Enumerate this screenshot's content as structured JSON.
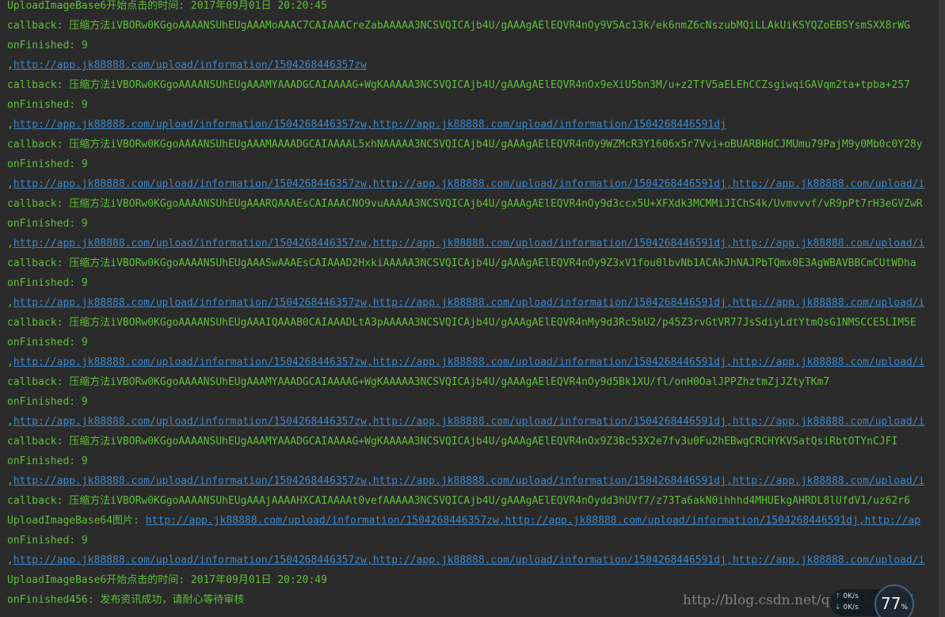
{
  "colors": {
    "background": "#2b2b2b",
    "log_text": "#5fbf3b",
    "link": "#3d87c9"
  },
  "lines": [
    {
      "type": "text",
      "text": "UploadImageBase6开始点击的时间: 2017年09月01日    20:20:45"
    },
    {
      "type": "text",
      "text": "callback: 压缩方法iVBORw0KGgoAAAANSUhEUgAAAMoAAAC7CAIAAACreZabAAAAA3NCSVQICAjb4U/gAAAgAElEQVR4nOy9V5Ac13k/ek6nmZ6cNszubMQiLLAkUiKSYQZoEBSYsmSXX8rWG"
    },
    {
      "type": "text",
      "text": "onFinished: 9"
    },
    {
      "type": "link",
      "prefix": ",",
      "text": "http://app.jk88888.com/upload/information/1504268446357zw"
    },
    {
      "type": "text",
      "text": "callback: 压缩方法iVBORw0KGgoAAAANSUhEUgAAAMYAAADGCAIAAAAG+WgKAAAAA3NCSVQICAjb4U/gAAAgAElEQVR4nOx9eXiU5bn3M/u+z2TfV5aELEhCCZsgiwqiGAVqm2ta+tpba+257"
    },
    {
      "type": "text",
      "text": "onFinished: 9"
    },
    {
      "type": "link",
      "prefix": ",",
      "text": "http://app.jk88888.com/upload/information/1504268446357zw,http://app.jk88888.com/upload/information/1504268446591dj"
    },
    {
      "type": "text",
      "text": "callback: 压缩方法iVBORw0KGgoAAAANSUhEUgAAAMAAAADGCAIAAAAL5xhNAAAAA3NCSVQICAjb4U/gAAAgAElEQVR4nOy9WZMcR3Y1606x5r7Vvi+oBUARBHdCJMUmu79PajM9y0Mb0c0Y28y"
    },
    {
      "type": "text",
      "text": "onFinished: 9"
    },
    {
      "type": "link",
      "prefix": ",",
      "text": "http://app.jk88888.com/upload/information/1504268446357zw,http://app.jk88888.com/upload/information/1504268446591dj,http://app.jk88888.com/upload/i"
    },
    {
      "type": "text",
      "text": "callback: 压缩方法iVBORw0KGgoAAAANSUhEUgAAARQAAAEsCAIAAACNO9vuAAAAA3NCSVQICAjb4U/gAAAgAElEQVR4nOy9d3ccx5U+XFXdk3MCMMiJIChS4k/Uvmvvvf/vR9pPt7rH3eGVZwR"
    },
    {
      "type": "text",
      "text": "onFinished: 9"
    },
    {
      "type": "link",
      "prefix": ",",
      "text": "http://app.jk88888.com/upload/information/1504268446357zw,http://app.jk88888.com/upload/information/1504268446591dj,http://app.jk88888.com/upload/i"
    },
    {
      "type": "text",
      "text": "callback: 压缩方法iVBORw0KGgoAAAANSUhEUgAAASwAAAEsCAIAAAD2HxkiAAAAA3NCSVQICAjb4U/gAAAgAElEQVR4nOy9Z3xV1fou0lbvNb1ACAkJhNAJPbTQmx0E3AgWBAVBBCmCUtWDha"
    },
    {
      "type": "text",
      "text": "onFinished: 9"
    },
    {
      "type": "link",
      "prefix": ",",
      "text": "http://app.jk88888.com/upload/information/1504268446357zw,http://app.jk88888.com/upload/information/1504268446591dj,http://app.jk88888.com/upload/i"
    },
    {
      "type": "text",
      "text": "callback: 压缩方法iVBORw0KGgoAAAANSUhEUgAAAIQAAAB0CAIAAADLtA3pAAAAA3NCSVQICAjb4U/gAAAgAElEQVR4nMy9d3Rc5bU2/p45Z3rvGtVR77JsSdiyLdtYtmQsG1NMSCCE5LIM5E"
    },
    {
      "type": "text",
      "text": "onFinished: 9"
    },
    {
      "type": "link",
      "prefix": ",",
      "text": "http://app.jk88888.com/upload/information/1504268446357zw,http://app.jk88888.com/upload/information/1504268446591dj,http://app.jk88888.com/upload/i"
    },
    {
      "type": "text",
      "text": "callback: 压缩方法iVBORw0KGgoAAAANSUhEUgAAAMYAAADGCAIAAAAG+WgKAAAAA3NCSVQICAjb4U/gAAAgAElEQVR4nOy9d5Bk1XU/fl/onH0OalJPPZhztmZjJZtyTKm7"
    },
    {
      "type": "text",
      "text": "onFinished: 9"
    },
    {
      "type": "link",
      "prefix": ",",
      "text": "http://app.jk88888.com/upload/information/1504268446357zw,http://app.jk88888.com/upload/information/1504268446591dj,http://app.jk88888.com/upload/i"
    },
    {
      "type": "text",
      "text": "callback: 压缩方法iVBORw0KGgoAAAANSUhEUgAAAMYAAADGCAIAAAAG+WgKAAAAA3NCSVQICAjb4U/gAAAgAElEQVR4nOx9Z3Bc53X2e7fv3u0Fu2hEBwgCRCHYKVSatQsiRbtOTYnCJFI"
    },
    {
      "type": "text",
      "text": "onFinished: 9"
    },
    {
      "type": "link",
      "prefix": ",",
      "text": "http://app.jk88888.com/upload/information/1504268446357zw,http://app.jk88888.com/upload/information/1504268446591dj,http://app.jk88888.com/upload/i"
    },
    {
      "type": "text",
      "text": "callback: 压缩方法iVBORw0KGgoAAAANSUhEUgAAAjAAAAHXCAIAAAAt0vefAAAAA3NCSVQICAjb4U/gAAAgAElEQVR4nOydd3hUVf7/z73Ta6akN0ihhhd4MHUEkgAHRDL8lUfdV1/uz62r6"
    },
    {
      "type": "mixed",
      "prefix": "UploadImageBase64图片: ",
      "text": "http://app.jk88888.com/upload/information/1504268446357zw,http://app.jk88888.com/upload/information/1504268446591dj,http://ap"
    },
    {
      "type": "text",
      "text": "onFinished: 9"
    },
    {
      "type": "link",
      "prefix": ",",
      "text": "http://app.jk88888.com/upload/information/1504268446357zw,http://app.jk88888.com/upload/information/1504268446591dj,http://app.jk88888.com/upload/i"
    },
    {
      "type": "text",
      "text": "UploadImageBase6开始点击的时间: 2017年09月01日    20:20:49"
    },
    {
      "type": "text",
      "text": "onFinished456: 发布资讯成功，请耐心等待审核"
    }
  ],
  "watermark": "http://blog.csdn.net/qq_34536167",
  "netmon": {
    "up_arrow": "↑",
    "down_arrow": "↓",
    "up_speed": "0K/s",
    "down_speed": "0K/s",
    "gauge_value": "77",
    "gauge_unit": "%"
  }
}
